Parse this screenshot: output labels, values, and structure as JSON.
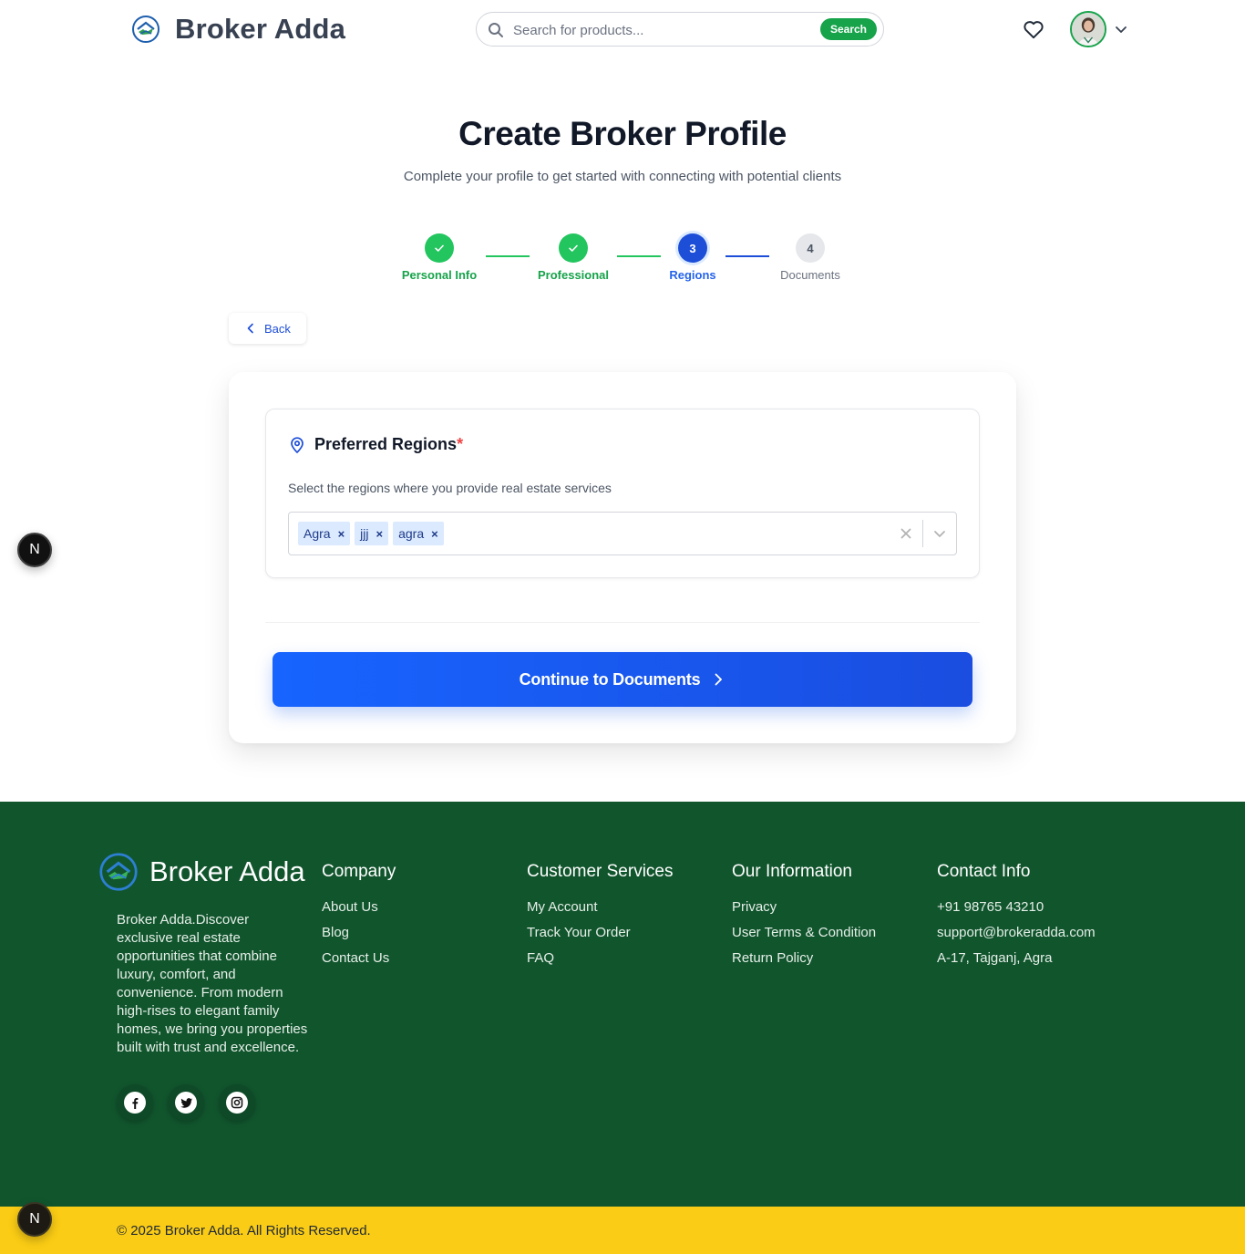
{
  "header": {
    "brand": "Broker Adda",
    "search": {
      "placeholder": "Search for products...",
      "value": "",
      "button": "Search"
    }
  },
  "page": {
    "title": "Create Broker Profile",
    "subtitle": "Complete your profile to get started with connecting with potential clients"
  },
  "stepper": {
    "steps": [
      {
        "number": "1",
        "label": "Personal Info",
        "status": "complete"
      },
      {
        "number": "2",
        "label": "Professional",
        "status": "complete"
      },
      {
        "number": "3",
        "label": "Regions",
        "status": "active"
      },
      {
        "number": "4",
        "label": "Documents",
        "status": "pending"
      }
    ]
  },
  "back": {
    "label": "Back"
  },
  "regions": {
    "title": "Preferred Regions",
    "required": "*",
    "description": "Select the regions where you provide real estate services",
    "selected": [
      "Agra",
      "jjj",
      "agra"
    ],
    "remove_symbol": "×"
  },
  "continue_button": {
    "label": "Continue to Documents"
  },
  "floating_badge": {
    "label": "N"
  },
  "footer": {
    "brand": "Broker Adda",
    "about": "Broker Adda.Discover exclusive real estate opportunities that combine luxury, comfort, and convenience. From modern high-rises to elegant family homes, we bring you properties built with trust and excellence.",
    "columns": [
      {
        "title": "Company",
        "items": [
          "About Us",
          "Blog",
          "Contact Us"
        ]
      },
      {
        "title": "Customer Services",
        "items": [
          "My Account",
          "Track Your Order",
          "FAQ"
        ]
      },
      {
        "title": "Our Information",
        "items": [
          "Privacy",
          "User Terms & Condition",
          "Return Policy"
        ]
      },
      {
        "title": "Contact Info",
        "items": [
          "+91 98765 43210",
          "support@brokeradda.com",
          "A-17, Tajganj, Agra"
        ]
      }
    ],
    "socials": [
      "facebook-icon",
      "twitter-icon",
      "instagram-icon"
    ],
    "copyright": "© 2025 Broker Adda. All Rights Reserved."
  },
  "colors": {
    "primary_blue": "#1d4ed8",
    "success_green": "#22c55e",
    "footer_green": "#11552d",
    "copyright_yellow": "#facc15"
  }
}
